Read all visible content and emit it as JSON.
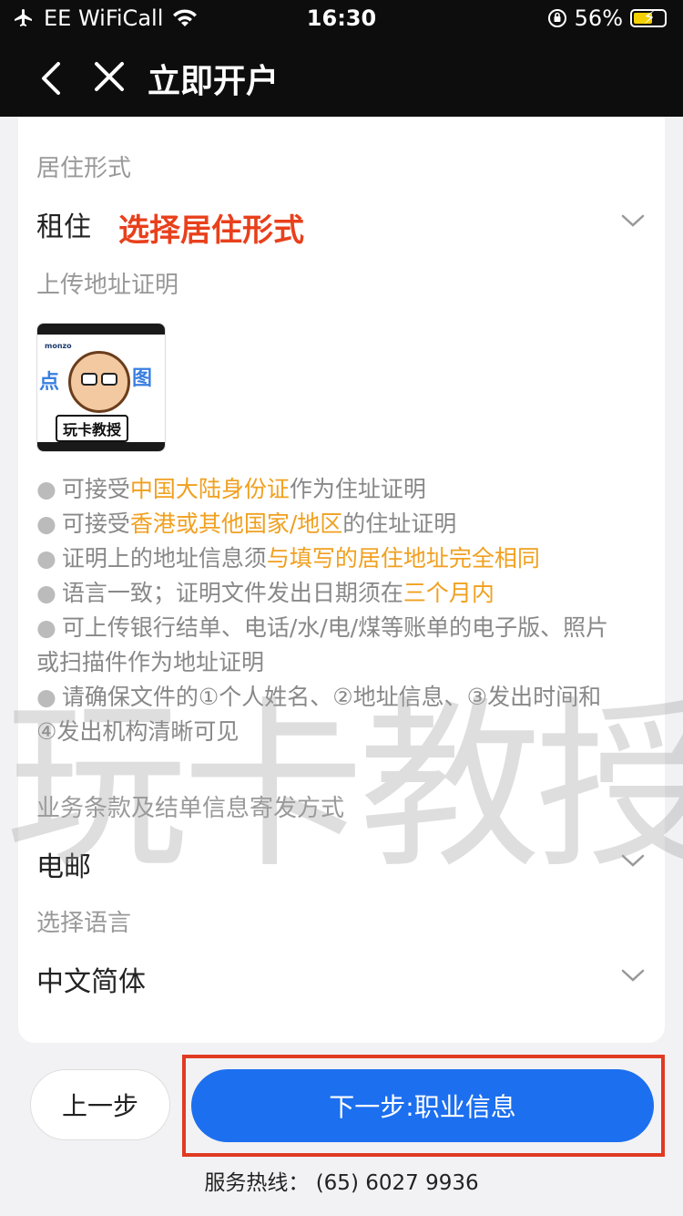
{
  "status": {
    "carrier": "EE WiFiCall",
    "time": "16:30",
    "battery": "56%"
  },
  "nav": {
    "title": "立即开户"
  },
  "residence": {
    "label": "居住形式",
    "value": "租住",
    "hint": "选择居住形式"
  },
  "upload": {
    "label": "上传地址证明",
    "thumb_brand": "monzo",
    "thumb_glyph_left": "点",
    "thumb_glyph_right": "图",
    "thumb_badge": "玩卡教授"
  },
  "bullets": [
    {
      "pre": "可接受",
      "hl": "中国大陆身份证",
      "post": "作为住址证明"
    },
    {
      "pre": "可接受",
      "hl": "香港或其他国家/地区",
      "post": "的住址证明"
    },
    {
      "pre": "证明上的地址信息须",
      "hl": "与填写的居住地址完全相同",
      "post": ""
    },
    {
      "pre": "语言一致；证明文件发出日期须在",
      "hl": "三个月内",
      "post": ""
    }
  ],
  "bullet5": {
    "line1": "可上传银行结单、电话/水/电/煤等账单的电子版、照片",
    "line2": "或扫描件作为地址证明"
  },
  "bullet6": {
    "line1": "请确保文件的①个人姓名、②地址信息、③发出时间和",
    "line2": "④发出机构清晰可见"
  },
  "delivery": {
    "label": "业务条款及结单信息寄发方式",
    "value": "电邮"
  },
  "language": {
    "label": "选择语言",
    "value": "中文简体"
  },
  "watermark": "玩卡教授",
  "buttons": {
    "prev": "上一步",
    "next": "下一步:职业信息"
  },
  "hotline": "服务热线： (65) 6027 9936",
  "colors": {
    "accent": "#1c6fef",
    "highlight": "#f0a020",
    "hint": "#e8401c",
    "box": "#e03a22"
  }
}
